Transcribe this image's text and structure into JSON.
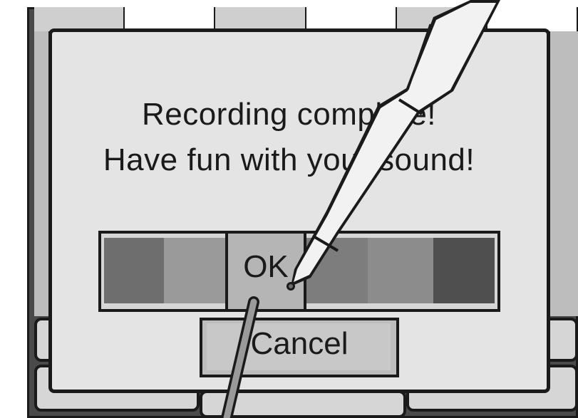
{
  "dialog": {
    "line1": "Recording complete!",
    "line2": "Have fun with your sound!"
  },
  "buttons": {
    "ok_label": "OK",
    "cancel_label": "Cancel"
  },
  "colors": {
    "bezel": "#4a4a4a",
    "panel": "#e4e4e4",
    "outline": "#1a1a1a",
    "stylus_body": "#f2f2f2",
    "stylus_shadow": "#9a9a9a"
  },
  "swatches": [
    "#6e6e6e",
    "#9a9a9a",
    "#b5b5b5",
    "#7d7d7d",
    "#8c8c8c",
    "#4f4f4f"
  ],
  "icons": [
    "stylus-icon"
  ]
}
